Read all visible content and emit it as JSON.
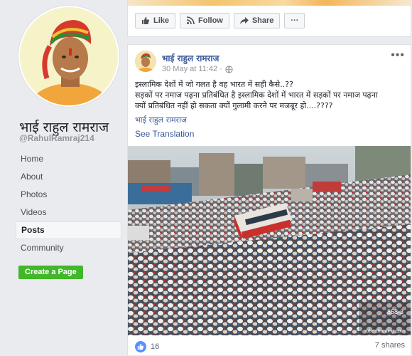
{
  "page": {
    "name": "भाई राहुल रामराज",
    "handle": "@RahulRamraj214"
  },
  "nav": {
    "items": [
      {
        "label": "Home"
      },
      {
        "label": "About"
      },
      {
        "label": "Photos"
      },
      {
        "label": "Videos"
      },
      {
        "label": "Posts",
        "active": true
      },
      {
        "label": "Community"
      }
    ],
    "create_page_label": "Create a Page"
  },
  "actions": {
    "like_label": "Like",
    "follow_label": "Follow",
    "share_label": "Share",
    "more_label": "···"
  },
  "post": {
    "author": "भाई राहुल रामराज",
    "timestamp": "30 May at 11:42 ·",
    "text_line1": "इस्लामिक देशों में जो गलत है वह भारत में सही कैसे..??",
    "text_line2": "सड़कों पर नमाज पढ़ना प्रतिबंधित है इस्लामिक देशों में भारत में सड़कों पर नमाज पढ़ना",
    "text_line3": "क्यों प्रतिबंधित नहीं हो सकता क्यों गुलामी करने पर मजबूर हो....????",
    "hashtag": "भाई राहुल रामराज",
    "see_translation": "See Translation",
    "like_count": "16",
    "shares": "7 shares",
    "watermark_code": "858-3",
    "watermark_site": "robertharding.com"
  },
  "colors": {
    "link": "#385898",
    "create_button": "#42b72a",
    "like_blue": "#5890ff"
  }
}
